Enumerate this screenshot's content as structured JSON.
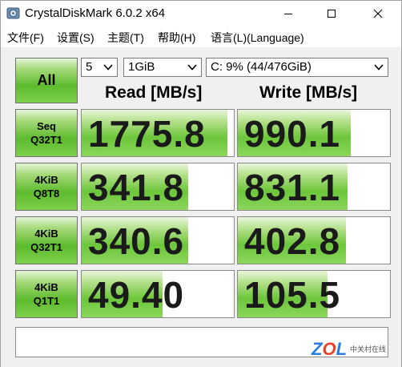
{
  "window": {
    "title": "CrystalDiskMark 6.0.2 x64"
  },
  "menu": [
    {
      "label": "文件(F)"
    },
    {
      "label": "设置(S)"
    },
    {
      "label": "主题(T)"
    },
    {
      "label": "帮助(H)"
    },
    {
      "label": "语言(L)(Language)"
    }
  ],
  "controls": {
    "all_label": "All",
    "count": "5",
    "size": "1GiB",
    "drive": "C: 9% (44/476GiB)"
  },
  "headers": {
    "read": "Read [MB/s]",
    "write": "Write [MB/s]"
  },
  "tests": [
    {
      "label": "Seq\nQ32T1",
      "read": "1775.8",
      "write": "990.1",
      "read_level": 0.96,
      "write_level": 0.74
    },
    {
      "label": "4KiB\nQ8T8",
      "read": "341.8",
      "write": "831.1",
      "read_level": 0.7,
      "write_level": 0.72
    },
    {
      "label": "4KiB\nQ32T1",
      "read": "340.6",
      "write": "402.8",
      "read_level": 0.7,
      "write_level": 0.71
    },
    {
      "label": "4KiB\nQ1T1",
      "read": "49.40",
      "write": "105.5",
      "read_level": 0.53,
      "write_level": 0.59
    }
  ],
  "comment": "",
  "watermark": {
    "logo_z": "Z",
    "logo_o": "O",
    "logo_l": "L",
    "text": "中关村在线"
  },
  "colors": {
    "button_green": "#5dbb2d",
    "bar_green": "#6cc63a"
  }
}
